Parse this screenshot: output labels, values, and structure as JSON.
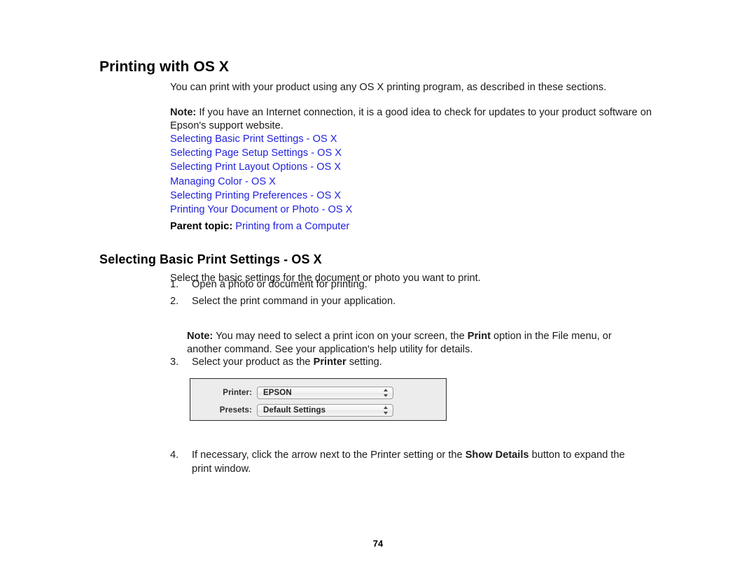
{
  "document": {
    "heading": "Printing with OS X",
    "intro": "You can print with your product using any OS X printing program, as described in these sections.",
    "note1_label": "Note:",
    "note1_text": " If you have an Internet connection, it is a good idea to check for updates to your product software on Epson's support website.",
    "links": [
      "Selecting Basic Print Settings - OS X",
      "Selecting Page Setup Settings - OS X",
      "Selecting Print Layout Options - OS X",
      "Managing Color - OS X",
      "Selecting Printing Preferences - OS X",
      "Printing Your Document or Photo - OS X"
    ],
    "parent_topic_label": "Parent topic:",
    "parent_topic_link": "Printing from a Computer",
    "section_heading": "Selecting Basic Print Settings - OS X",
    "section_intro": "Select the basic settings for the document or photo you want to print.",
    "steps": [
      {
        "num": "1.",
        "text": "Open a photo or document for printing."
      },
      {
        "num": "2.",
        "text": "Select the print command in your application."
      }
    ],
    "note2_label": "Note:",
    "note2_part1": " You may need to select a print icon on your screen, the ",
    "note2_bold": "Print",
    "note2_part2": " option in the File menu, or another command. See your application's help utility for details.",
    "step3": {
      "num": "3.",
      "part1": "Select your product as the ",
      "bold": "Printer",
      "part2": " setting."
    },
    "step4": {
      "num": "4.",
      "part1": "If necessary, click the arrow next to the Printer setting or the ",
      "bold": "Show Details",
      "part2": " button to expand the print window."
    },
    "page_number": "74",
    "link_color": "#2222dd"
  },
  "print_dialog": {
    "printer_label": "Printer:",
    "printer_value": "EPSON",
    "presets_label": "Presets:",
    "presets_value": "Default Settings"
  }
}
